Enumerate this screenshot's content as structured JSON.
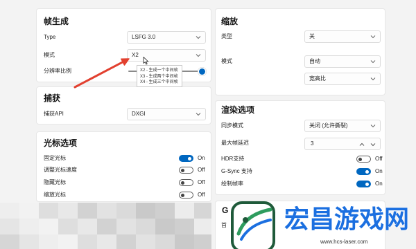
{
  "frame_generation": {
    "title": "帧生成",
    "type_label": "Type",
    "type_value": "LSFG 3.0",
    "mode_label": "模式",
    "mode_value": "X2",
    "mode_menu_options": [
      "X2 - 生成一个中间帧",
      "X3 - 生成两个中间帧",
      "X4 - 生成三个中间帧"
    ],
    "resolution_scale_label": "分辨率比例",
    "resolution_scale_level": 1.0
  },
  "capture": {
    "title": "捕获",
    "api_label": "捕获API",
    "api_value": "DXGI"
  },
  "cursor_options": {
    "title": "光标选项",
    "items": [
      {
        "label": "固定光标",
        "state": "On",
        "on": true
      },
      {
        "label": "调整光标速度",
        "state": "Off",
        "on": false
      },
      {
        "label": "隐藏光标",
        "state": "Off",
        "on": false
      },
      {
        "label": "缩放光标",
        "state": "Off",
        "on": false
      }
    ]
  },
  "scaling": {
    "title": "缩放",
    "type_label": "类型",
    "type_value": "关",
    "mode_label": "模式",
    "mode_value": "自动",
    "aspect_value": "宽高比"
  },
  "rendering": {
    "title": "渲染选项",
    "sync_label": "同步模式",
    "sync_value": "关闭 (允许撕裂)",
    "max_frame_latency_label": "最大帧延迟",
    "max_frame_latency_value": "3",
    "toggles": [
      {
        "label": "HDR支持",
        "state": "Off",
        "on": false
      },
      {
        "label": "G-Sync 支持",
        "state": "On",
        "on": true
      },
      {
        "label": "绘制帧率",
        "state": "On",
        "on": true
      }
    ]
  },
  "partial_card": {
    "title": "G",
    "label": "首"
  },
  "watermark": {
    "name": "宏昌游戏网",
    "url": "www.hcs-laser.com"
  },
  "icons": {
    "dropdown": "chevron-down-icon",
    "spin_up": "chevron-up-icon",
    "spin_down": "chevron-down-icon",
    "annotation": "red-arrow-icon",
    "pointer": "mouse-pointer-icon",
    "logo": "watermark-logo-icon"
  },
  "colors": {
    "accent": "#0067c0",
    "annotation_arrow": "#e2402f",
    "watermark_text": "#1b6fe0",
    "background": "#f3f3f3"
  }
}
